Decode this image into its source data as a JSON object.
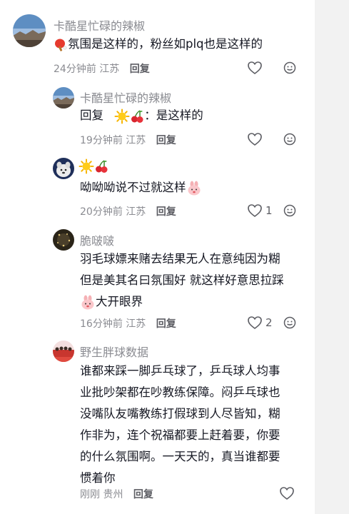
{
  "comments": [
    {
      "username": "卡酷星忙碌的辣椒",
      "text": "氛围是这样的，粉丝如plq也是这样的",
      "time": "24分钟前",
      "location": "江苏",
      "reply": "回复",
      "likes": null
    },
    {
      "username": "卡酷星忙碌的辣椒",
      "reply_prefix": "回复",
      "text": "：是这样的",
      "time": "19分钟前",
      "location": "江苏",
      "reply": "回复",
      "likes": null
    },
    {
      "username": "",
      "text": "呦呦呦说不过就这样",
      "time": "20分钟前",
      "location": "江苏",
      "reply": "回复",
      "likes": "1"
    },
    {
      "username": "脆啵啵",
      "text_lines": [
        "羽毛球嫖来赌去结果无人在意纯因为糊",
        "但是美其名曰氛围好 就这样好意思拉踩",
        "大开眼界"
      ],
      "time": "16分钟前",
      "location": "江苏",
      "reply": "回复",
      "likes": "2"
    },
    {
      "username": "野生胖球数据",
      "text_lines": [
        "谁都来踩一脚乒乓球了，乒乓球人均事",
        "业批吵架都在吵教练保障。闷乒乓球也",
        "没嘴队友嘴教练打假球到人尽皆知，糊",
        "作非为，连个祝福都要上赶着要，你要",
        "的什么氛围啊。一天天的，真当谁都要",
        "惯着你"
      ],
      "time": "刚刚",
      "location": "贵州",
      "reply": "回复",
      "likes": null
    }
  ],
  "colors": {
    "username": "#8a8b91",
    "text": "#161823",
    "meta": "#8a8b91",
    "reply": "#5c5d63",
    "strip": "#f2f2f2"
  },
  "icons": [
    "ping-pong-icon",
    "sun-icon",
    "cherry-icon",
    "bunny-emoji-icon",
    "heart-icon",
    "emoji-reaction-icon"
  ]
}
